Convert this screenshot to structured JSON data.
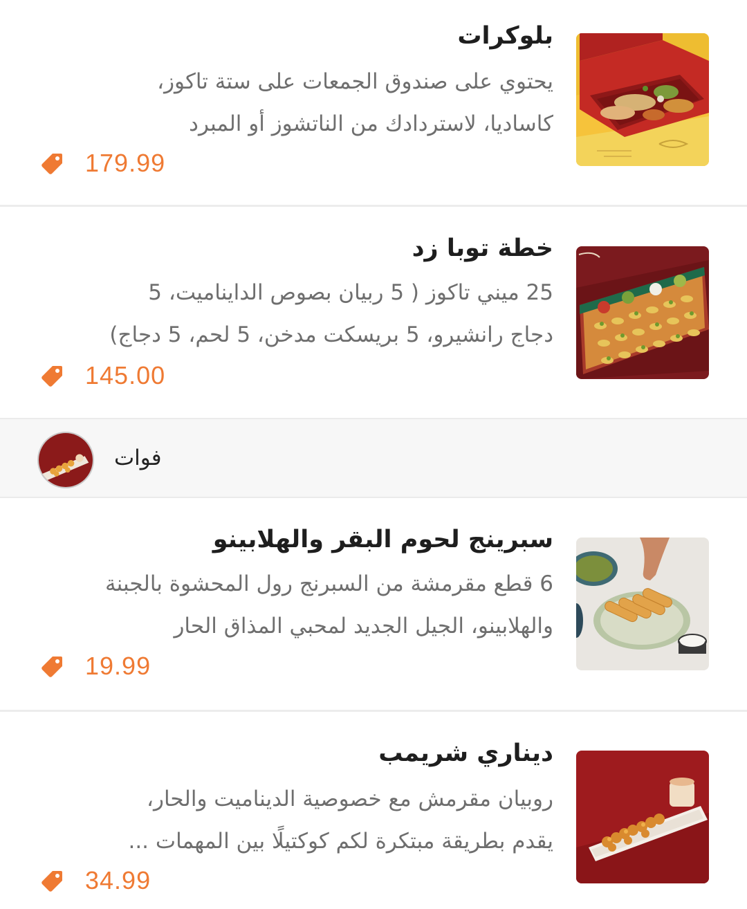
{
  "items": [
    {
      "title": "بلوكرات",
      "description_lines": [
        "يحتوي على صندوق الجمعات على ستة تاكوز،",
        "كاساديا، لاستردادك من الناتشوز أو المبرد"
      ],
      "price": "179.99"
    },
    {
      "title": "خطة توبا زد",
      "description_lines": [
        "25 ميني تاكوز ( 5 ربيان بصوص الدايناميت، 5",
        "دجاج رانشيرو، 5 بريسكت مدخن، 5 لحم، 5 دجاج)"
      ],
      "price": "145.00"
    },
    {
      "title": "سبرينج لحوم البقر والهلابينو",
      "description_lines": [
        "6 قطع مقرمشة من السبرنج رول المحشوة بالجبنة",
        "والهلابينو، الجيل الجديد لمحبي المذاق الحار"
      ],
      "price": "19.99"
    },
    {
      "title": "ديناري شريمب",
      "description_lines": [
        "روبيان مقرمش مع خصوصية الديناميت والحار،",
        "يقدم بطريقة مبتكرة لكم كوكتيلًا بين المهمات ..."
      ],
      "price": "34.99"
    }
  ],
  "category": {
    "label": "فوات"
  },
  "colors": {
    "price": "#ef7a33",
    "title": "#1e1e1e",
    "description": "#6e6e6e",
    "divider": "#ececec",
    "category_bg": "#f7f7f7"
  },
  "icons": {
    "price": "price-tag-icon"
  }
}
